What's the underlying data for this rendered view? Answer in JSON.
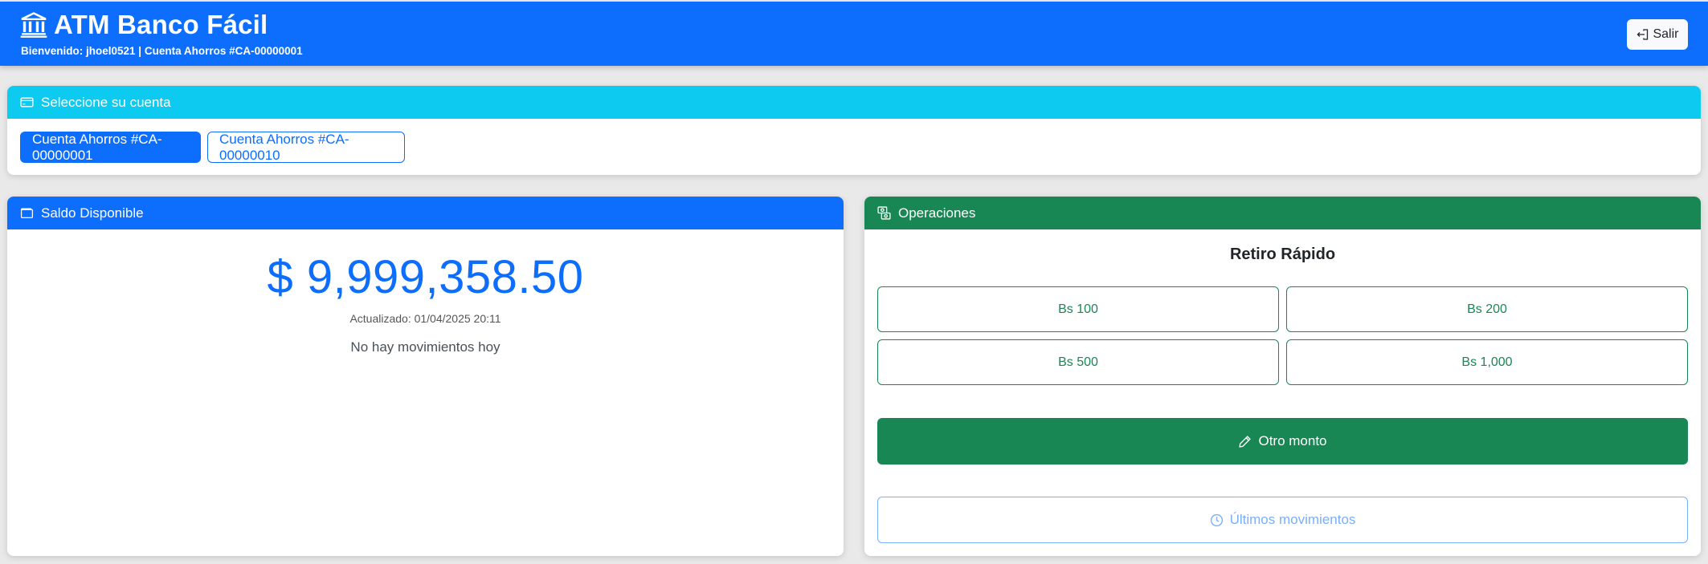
{
  "header": {
    "app_title": "ATM Banco Fácil",
    "brand_icon": "bank-icon",
    "subtitle": "Bienvenido: jhoel0521 | Cuenta Ahorros #CA-00000001",
    "logout_label": "Salir",
    "logout_icon": "logout-icon",
    "color": "#0d6efd"
  },
  "accounts": {
    "header": "Seleccione su cuenta",
    "header_icon": "credit-card-icon",
    "header_color": "#0dcaf0",
    "items": [
      {
        "label": "Cuenta Ahorros #CA-00000001",
        "selected": true
      },
      {
        "label": "Cuenta Ahorros #CA-00000010",
        "selected": false
      }
    ]
  },
  "balance": {
    "header": "Saldo Disponible",
    "header_icon": "wallet-icon",
    "amount": "$ 9,999,358.50",
    "updated": "Actualizado: 01/04/2025 20:11",
    "note": "No hay movimientos hoy"
  },
  "operations": {
    "header": "Operaciones",
    "header_icon": "cash-exchange-icon",
    "header_color": "#198754",
    "quick_title": "Retiro Rápido",
    "quick_amounts": [
      "Bs 100",
      "Bs 200",
      "Bs 500",
      "Bs 1,000"
    ],
    "other_amount_label": "Otro monto",
    "other_amount_icon": "pencil-icon",
    "history_label": "Últimos movimientos",
    "history_icon": "clock-icon"
  }
}
